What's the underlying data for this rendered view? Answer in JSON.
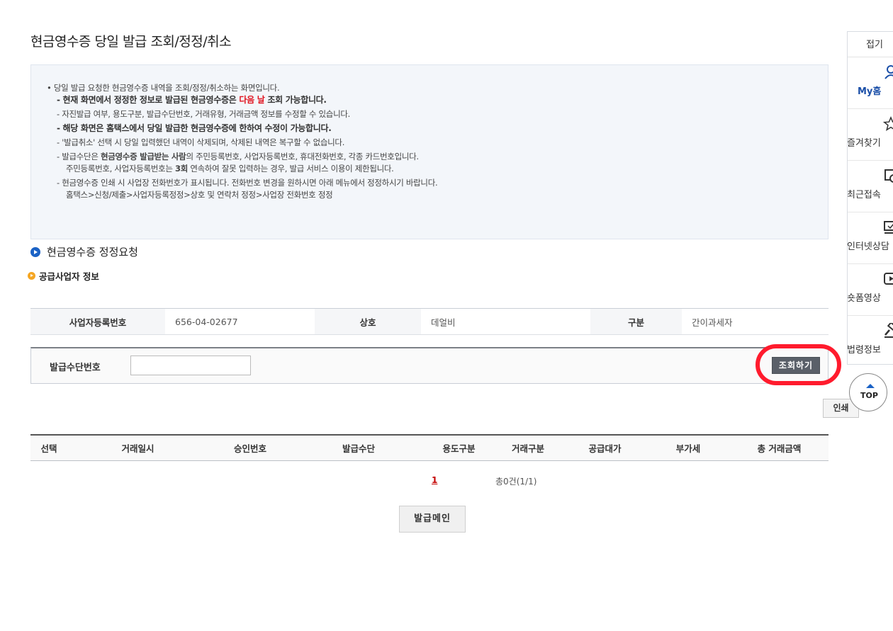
{
  "page": {
    "title": "현금영수증 당일 발급 조회/정정/취소"
  },
  "notice": {
    "line1": "• 당일 발급 요청한 현금영수증 내역을 조회/정정/취소하는 화면입니다.",
    "line2_a": "- 현재 화면에서 정정한 정보로 발급된 현금영수증은 ",
    "line2_red": "다음 날",
    "line2_b": " 조회 가능합니다.",
    "line3": "- 자진발급 여부, 용도구분, 발급수단번호, 거래유형, 거래금액 정보를 수정할 수 있습니다.",
    "line4": "- 해당 화면은 홈택스에서 당일 발급한 현금영수증에 한하여 수정이 가능합니다.",
    "line5": "- '발급취소' 선택 시 당일 입력했던 내역이 삭제되며, 삭제된 내역은 복구할 수 없습니다.",
    "line6_a": "- 발급수단은 ",
    "line6_strong": "현금영수증 발급받는 사람",
    "line6_b": "의 주민등록번호, 사업자등록번호, 휴대전화번호, 각종 카드번호입니다.",
    "line7_a": "주민등록번호, 사업자등록번호는 ",
    "line7_strong": "3회",
    "line7_b": " 연속하여 잘못 입력하는 경우, 발급 서비스 이용이 제한됩니다.",
    "line8": "- 현금영수증 인쇄 시 사업장 전화번호가 표시됩니다. 전화번호 변경을 원하시면 아래 메뉴에서 정정하시기 바랍니다.",
    "line9": "홈택스>신청/제출>사업자등록정정>상호 및 연락처 정정>사업장 전화번호 정정"
  },
  "section": {
    "title": "현금영수증 정정요청",
    "subtitle": "공급사업자 정보"
  },
  "supplier": {
    "reg_no_label": "사업자등록번호",
    "reg_no": "656-04-02677",
    "name_label": "상호",
    "name": "데얼비",
    "type_label": "구분",
    "type": "간이과세자"
  },
  "search": {
    "label": "발급수단번호",
    "value": "",
    "button": "조회하기"
  },
  "print_button": "인쇄",
  "result_table": {
    "columns": [
      "선택",
      "거래일시",
      "승인번호",
      "발급수단",
      "용도구분",
      "거래구분",
      "공급대가",
      "부가세",
      "총 거래금액"
    ]
  },
  "pager": {
    "current": "1",
    "total": "총0건(1/1)"
  },
  "issue_button": "발급메인",
  "quick_menu": {
    "collapse": "접기",
    "items": [
      {
        "label": "My홈",
        "icon": "person-icon"
      },
      {
        "label": "즐겨찾기",
        "icon": "star-icon"
      },
      {
        "label": "최근접속",
        "icon": "recent-icon"
      },
      {
        "label": "인터넷상담",
        "icon": "chat-icon"
      },
      {
        "label": "숏폼영상",
        "icon": "play-icon"
      },
      {
        "label": "법령정보",
        "icon": "gavel-icon"
      }
    ],
    "top": "TOP"
  },
  "colors": {
    "accent": "#1b62c5",
    "highlight_ring": "#ff1b2d",
    "red_text": "#e0131f"
  }
}
